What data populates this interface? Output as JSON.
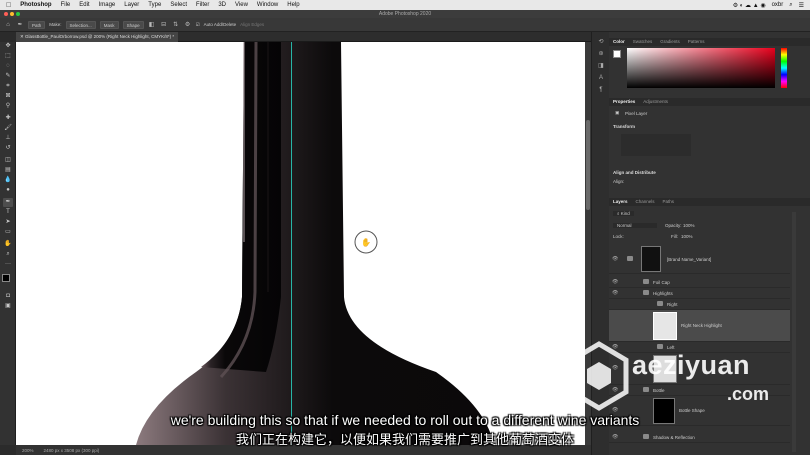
{
  "menubar": {
    "app": "Photoshop",
    "items": [
      "File",
      "Edit",
      "Image",
      "Layer",
      "Type",
      "Select",
      "Filter",
      "3D",
      "View",
      "Window",
      "Help"
    ],
    "user": "oxbr"
  },
  "window": {
    "title": "Adobe Photoshop 2020"
  },
  "options_bar": {
    "mode": "Path",
    "make_label": "Make:",
    "selection_button": "Selection...",
    "mask_button": "Mask",
    "shape_button": "Shape",
    "auto_add_delete": "Auto Add/Delete",
    "align_edges": "Align Edges"
  },
  "document": {
    "tab_title": "GlassBottle_PaulOrborrow.psd @ 200% (Right Neck Highlight, CMYK/8*) *",
    "zoom": "200%",
    "size": "2480 px x 3508 px (300 ppi)"
  },
  "color_panel": {
    "tabs": [
      "Color",
      "Swatches",
      "Gradients",
      "Patterns"
    ],
    "accent": "#e8001c"
  },
  "properties_panel": {
    "tabs": [
      "Properties",
      "Adjustments"
    ],
    "layer_kind": "Pixel Layer",
    "transform_label": "Transform",
    "align_label": "Align and Distribute",
    "align_sub": "Align:"
  },
  "layers_panel": {
    "tabs": [
      "Layers",
      "Channels",
      "Paths"
    ],
    "filter": "Kind",
    "blend_mode": "Normal",
    "opacity_label": "Opacity:",
    "opacity": "100%",
    "lock_label": "Lock:",
    "fill_label": "Fill:",
    "fill": "100%",
    "layers": [
      {
        "name": "[Brand Name_Variant]"
      },
      {
        "name": "Foil Cap"
      },
      {
        "name": "Highlights"
      },
      {
        "name": "Right"
      },
      {
        "name": "Right Neck Highlight"
      },
      {
        "name": "Left"
      },
      {
        "name": "Bottle"
      },
      {
        "name": "Bottle Shape"
      },
      {
        "name": "Shadow & Reflection"
      }
    ]
  },
  "subtitles": {
    "en": "we're building this so that if we needed to roll out to a different wine variants",
    "zh": "我们正在构建它，以便如果我们需要推广到其他葡萄酒变体"
  },
  "watermark": {
    "brand": "aeziyuan",
    "suffix": ".com"
  }
}
